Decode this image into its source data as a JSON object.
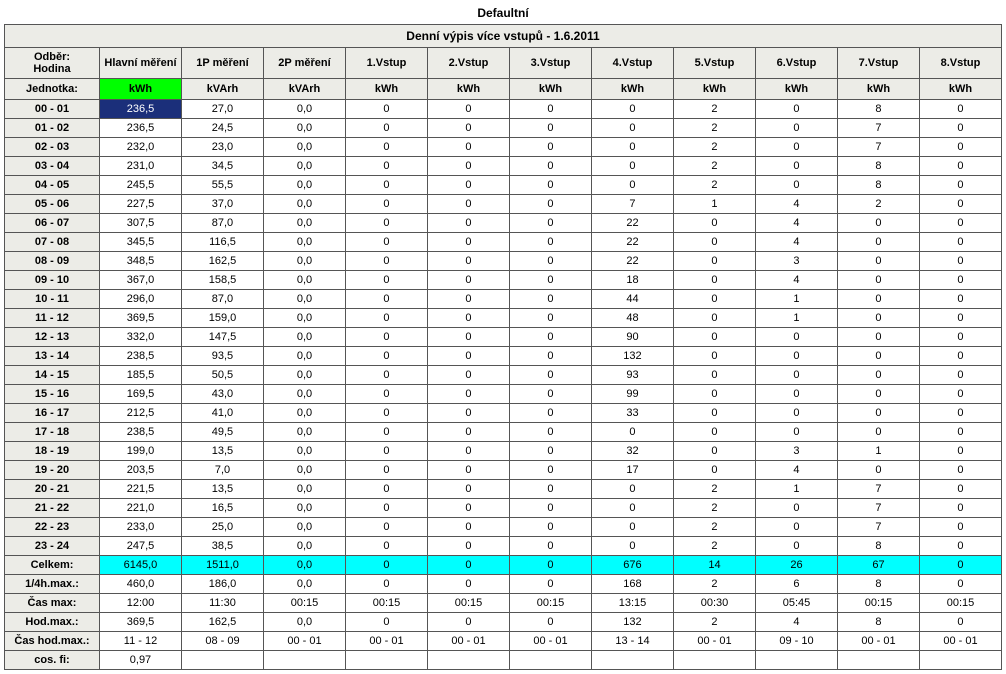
{
  "title": "Defaultní",
  "subtitle": "Denní výpis více vstupů - 1.6.2011",
  "columns": [
    "Odběr: Hodina",
    "Hlavní měření",
    "1P měření",
    "2P měření",
    "1.Vstup",
    "2.Vstup",
    "3.Vstup",
    "4.Vstup",
    "5.Vstup",
    "6.Vstup",
    "7.Vstup",
    "8.Vstup"
  ],
  "units_label": "Jednotka:",
  "units": [
    "kWh",
    "kVArh",
    "kVArh",
    "kWh",
    "kWh",
    "kWh",
    "kWh",
    "kWh",
    "kWh",
    "kWh",
    "kWh"
  ],
  "rows": [
    {
      "h": "00 - 01",
      "v": [
        "236,5",
        "27,0",
        "0,0",
        "0",
        "0",
        "0",
        "0",
        "2",
        "0",
        "8",
        "0"
      ],
      "hl": true
    },
    {
      "h": "01 - 02",
      "v": [
        "236,5",
        "24,5",
        "0,0",
        "0",
        "0",
        "0",
        "0",
        "2",
        "0",
        "7",
        "0"
      ]
    },
    {
      "h": "02 - 03",
      "v": [
        "232,0",
        "23,0",
        "0,0",
        "0",
        "0",
        "0",
        "0",
        "2",
        "0",
        "7",
        "0"
      ]
    },
    {
      "h": "03 - 04",
      "v": [
        "231,0",
        "34,5",
        "0,0",
        "0",
        "0",
        "0",
        "0",
        "2",
        "0",
        "8",
        "0"
      ]
    },
    {
      "h": "04 - 05",
      "v": [
        "245,5",
        "55,5",
        "0,0",
        "0",
        "0",
        "0",
        "0",
        "2",
        "0",
        "8",
        "0"
      ]
    },
    {
      "h": "05 - 06",
      "v": [
        "227,5",
        "37,0",
        "0,0",
        "0",
        "0",
        "0",
        "7",
        "1",
        "4",
        "2",
        "0"
      ]
    },
    {
      "h": "06 - 07",
      "v": [
        "307,5",
        "87,0",
        "0,0",
        "0",
        "0",
        "0",
        "22",
        "0",
        "4",
        "0",
        "0"
      ]
    },
    {
      "h": "07 - 08",
      "v": [
        "345,5",
        "116,5",
        "0,0",
        "0",
        "0",
        "0",
        "22",
        "0",
        "4",
        "0",
        "0"
      ]
    },
    {
      "h": "08 - 09",
      "v": [
        "348,5",
        "162,5",
        "0,0",
        "0",
        "0",
        "0",
        "22",
        "0",
        "3",
        "0",
        "0"
      ]
    },
    {
      "h": "09 - 10",
      "v": [
        "367,0",
        "158,5",
        "0,0",
        "0",
        "0",
        "0",
        "18",
        "0",
        "4",
        "0",
        "0"
      ]
    },
    {
      "h": "10 - 11",
      "v": [
        "296,0",
        "87,0",
        "0,0",
        "0",
        "0",
        "0",
        "44",
        "0",
        "1",
        "0",
        "0"
      ]
    },
    {
      "h": "11 - 12",
      "v": [
        "369,5",
        "159,0",
        "0,0",
        "0",
        "0",
        "0",
        "48",
        "0",
        "1",
        "0",
        "0"
      ]
    },
    {
      "h": "12 - 13",
      "v": [
        "332,0",
        "147,5",
        "0,0",
        "0",
        "0",
        "0",
        "90",
        "0",
        "0",
        "0",
        "0"
      ]
    },
    {
      "h": "13 - 14",
      "v": [
        "238,5",
        "93,5",
        "0,0",
        "0",
        "0",
        "0",
        "132",
        "0",
        "0",
        "0",
        "0"
      ]
    },
    {
      "h": "14 - 15",
      "v": [
        "185,5",
        "50,5",
        "0,0",
        "0",
        "0",
        "0",
        "93",
        "0",
        "0",
        "0",
        "0"
      ]
    },
    {
      "h": "15 - 16",
      "v": [
        "169,5",
        "43,0",
        "0,0",
        "0",
        "0",
        "0",
        "99",
        "0",
        "0",
        "0",
        "0"
      ]
    },
    {
      "h": "16 - 17",
      "v": [
        "212,5",
        "41,0",
        "0,0",
        "0",
        "0",
        "0",
        "33",
        "0",
        "0",
        "0",
        "0"
      ]
    },
    {
      "h": "17 - 18",
      "v": [
        "238,5",
        "49,5",
        "0,0",
        "0",
        "0",
        "0",
        "0",
        "0",
        "0",
        "0",
        "0"
      ]
    },
    {
      "h": "18 - 19",
      "v": [
        "199,0",
        "13,5",
        "0,0",
        "0",
        "0",
        "0",
        "32",
        "0",
        "3",
        "1",
        "0"
      ]
    },
    {
      "h": "19 - 20",
      "v": [
        "203,5",
        "7,0",
        "0,0",
        "0",
        "0",
        "0",
        "17",
        "0",
        "4",
        "0",
        "0"
      ]
    },
    {
      "h": "20 - 21",
      "v": [
        "221,5",
        "13,5",
        "0,0",
        "0",
        "0",
        "0",
        "0",
        "2",
        "1",
        "7",
        "0"
      ]
    },
    {
      "h": "21 - 22",
      "v": [
        "221,0",
        "16,5",
        "0,0",
        "0",
        "0",
        "0",
        "0",
        "2",
        "0",
        "7",
        "0"
      ]
    },
    {
      "h": "22 - 23",
      "v": [
        "233,0",
        "25,0",
        "0,0",
        "0",
        "0",
        "0",
        "0",
        "2",
        "0",
        "7",
        "0"
      ]
    },
    {
      "h": "23 - 24",
      "v": [
        "247,5",
        "38,5",
        "0,0",
        "0",
        "0",
        "0",
        "0",
        "2",
        "0",
        "8",
        "0"
      ]
    }
  ],
  "summary": [
    {
      "label": "Celkem:",
      "v": [
        "6145,0",
        "1511,0",
        "0,0",
        "0",
        "0",
        "0",
        "676",
        "14",
        "26",
        "67",
        "0"
      ],
      "cls": "celkem"
    },
    {
      "label": "1/4h.max.:",
      "v": [
        "460,0",
        "186,0",
        "0,0",
        "0",
        "0",
        "0",
        "168",
        "2",
        "6",
        "8",
        "0"
      ]
    },
    {
      "label": "Čas max:",
      "v": [
        "12:00",
        "11:30",
        "00:15",
        "00:15",
        "00:15",
        "00:15",
        "13:15",
        "00:30",
        "05:45",
        "00:15",
        "00:15"
      ]
    },
    {
      "label": "Hod.max.:",
      "v": [
        "369,5",
        "162,5",
        "0,0",
        "0",
        "0",
        "0",
        "132",
        "2",
        "4",
        "8",
        "0"
      ]
    },
    {
      "label": "Čas hod.max.:",
      "v": [
        "11 - 12",
        "08 - 09",
        "00 - 01",
        "00 - 01",
        "00 - 01",
        "00 - 01",
        "13 - 14",
        "00 - 01",
        "09 - 10",
        "00 - 01",
        "00 - 01"
      ]
    },
    {
      "label": "cos. fi:",
      "v": [
        "0,97",
        "",
        "",
        "",
        "",
        "",
        "",
        "",
        "",
        "",
        ""
      ]
    }
  ]
}
